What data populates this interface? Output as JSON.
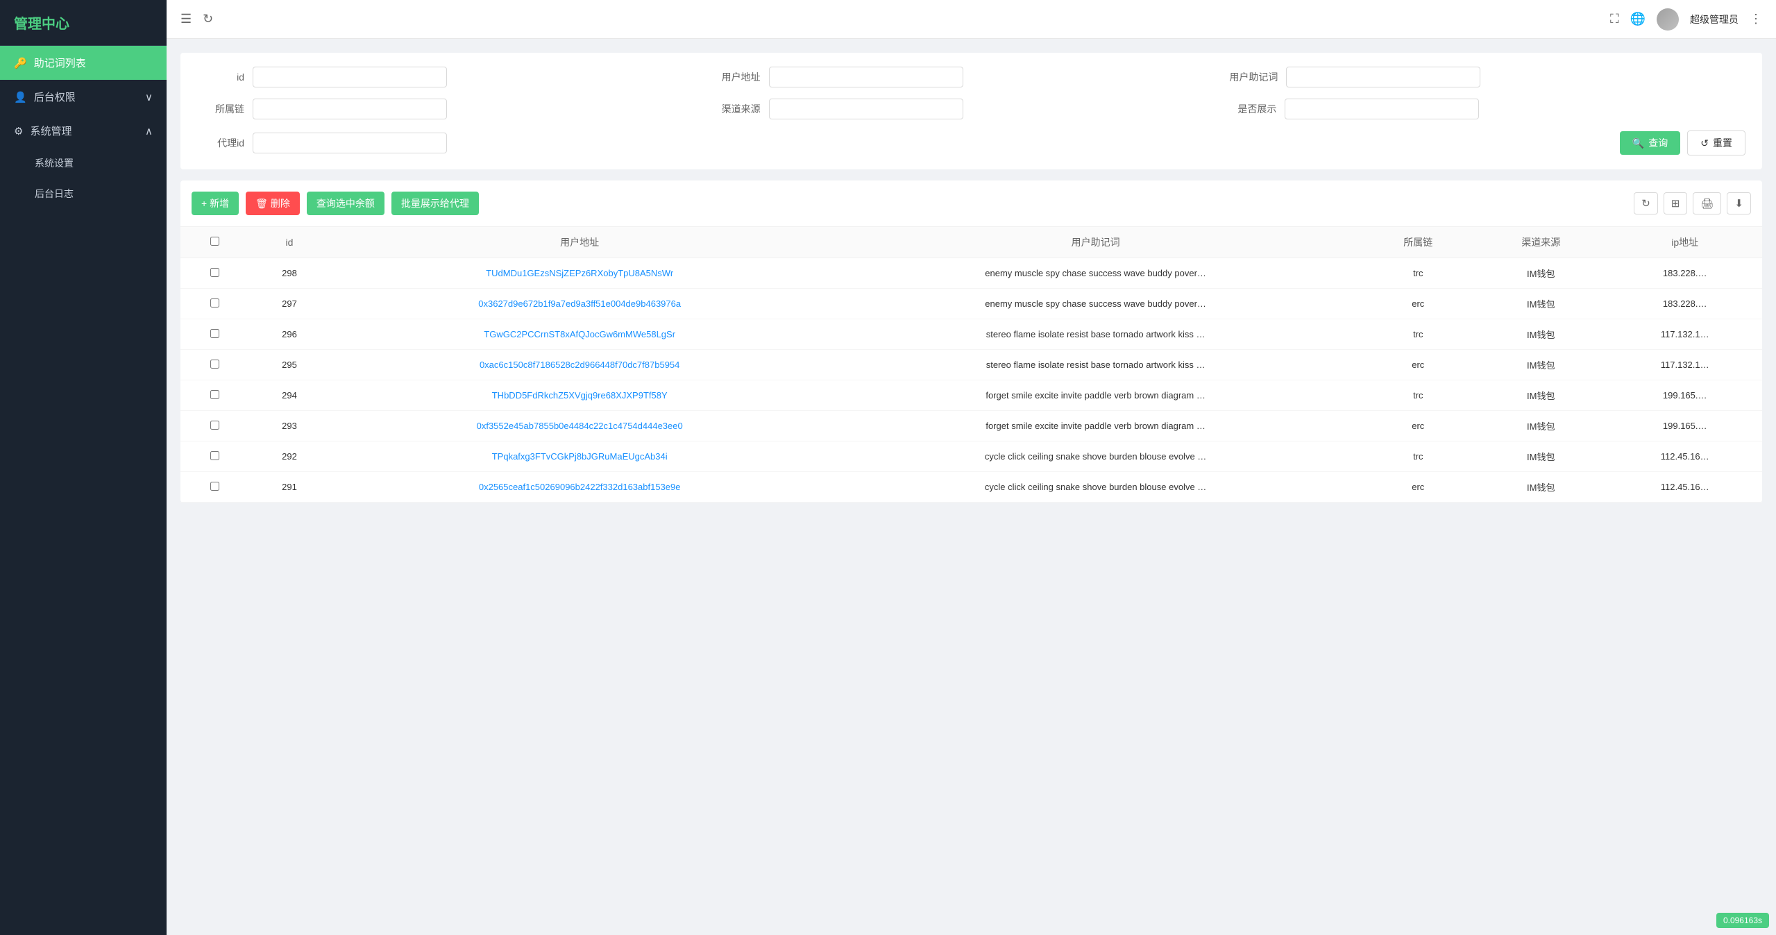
{
  "sidebar": {
    "logo": "管理中心",
    "items": [
      {
        "id": "mnemonic-list",
        "label": "助记词列表",
        "icon": "🔑",
        "active": true
      },
      {
        "id": "backend-permissions",
        "label": "后台权限",
        "icon": "👤",
        "expandable": true,
        "expanded": false
      },
      {
        "id": "system-management",
        "label": "系统管理",
        "icon": "⚙",
        "expandable": true,
        "expanded": true
      }
    ],
    "sub_items": [
      {
        "id": "system-settings",
        "label": "系统设置"
      },
      {
        "id": "backend-log",
        "label": "后台日志"
      }
    ]
  },
  "header": {
    "admin_name": "超级管理员",
    "refresh_icon": "↻",
    "fullscreen_icon": "⛶",
    "globe_icon": "🌐",
    "more_icon": "⋮"
  },
  "filter": {
    "fields": [
      {
        "id": "id",
        "label": "id",
        "placeholder": ""
      },
      {
        "id": "user-address",
        "label": "用户地址",
        "placeholder": ""
      },
      {
        "id": "user-mnemonic",
        "label": "用户助记词",
        "placeholder": ""
      },
      {
        "id": "chain",
        "label": "所属链",
        "placeholder": ""
      },
      {
        "id": "channel-source",
        "label": "渠道来源",
        "placeholder": ""
      },
      {
        "id": "show-flag",
        "label": "是否展示",
        "placeholder": ""
      },
      {
        "id": "agent-id",
        "label": "代理id",
        "placeholder": ""
      }
    ],
    "query_btn": "查询",
    "reset_btn": "重置"
  },
  "toolbar": {
    "add_btn": "+ 新增",
    "delete_btn": "删除",
    "query_balance_btn": "查询选中余额",
    "batch_show_btn": "批量展示给代理"
  },
  "table": {
    "columns": [
      "id",
      "用户地址",
      "用户助记词",
      "所属链",
      "渠道来源",
      "ip地址"
    ],
    "rows": [
      {
        "id": "298",
        "address": "TUdMDu1GEzsNSjZEPz6RXobyTpU8A5NsWr",
        "mnemonic": "enemy muscle spy chase success wave buddy pover…",
        "chain": "trc",
        "channel": "IM钱包",
        "ip": "183.228.…"
      },
      {
        "id": "297",
        "address": "0x3627d9e672b1f9a7ed9a3ff51e004de9b463976a",
        "mnemonic": "enemy muscle spy chase success wave buddy pover…",
        "chain": "erc",
        "channel": "IM钱包",
        "ip": "183.228.…"
      },
      {
        "id": "296",
        "address": "TGwGC2PCCrnST8xAfQJocGw6mMWe58LgSr",
        "mnemonic": "stereo flame isolate resist base tornado artwork kiss …",
        "chain": "trc",
        "channel": "IM钱包",
        "ip": "117.132.1…"
      },
      {
        "id": "295",
        "address": "0xac6c150c8f7186528c2d966448f70dc7f87b5954",
        "mnemonic": "stereo flame isolate resist base tornado artwork kiss …",
        "chain": "erc",
        "channel": "IM钱包",
        "ip": "117.132.1…"
      },
      {
        "id": "294",
        "address": "THbDD5FdRkchZ5XVgjq9re68XJXP9Tf58Y",
        "mnemonic": "forget smile excite invite paddle verb brown diagram …",
        "chain": "trc",
        "channel": "IM钱包",
        "ip": "199.165.…"
      },
      {
        "id": "293",
        "address": "0xf3552e45ab7855b0e4484c22c1c4754d444e3ee0",
        "mnemonic": "forget smile excite invite paddle verb brown diagram …",
        "chain": "erc",
        "channel": "IM钱包",
        "ip": "199.165.…"
      },
      {
        "id": "292",
        "address": "TPqkafxg3FTvCGkPj8bJGRuMaEUgcAb34i",
        "mnemonic": "cycle click ceiling snake shove burden blouse evolve …",
        "chain": "trc",
        "channel": "IM钱包",
        "ip": "112.45.16…"
      },
      {
        "id": "291",
        "address": "0x2565ceaf1c50269096b2422f332d163abf153e9e",
        "mnemonic": "cycle click ceiling snake shove burden blouse evolve …",
        "chain": "erc",
        "channel": "IM钱包",
        "ip": "112.45.16…"
      }
    ]
  },
  "bottom_bar": {
    "text": "0.096163s"
  }
}
